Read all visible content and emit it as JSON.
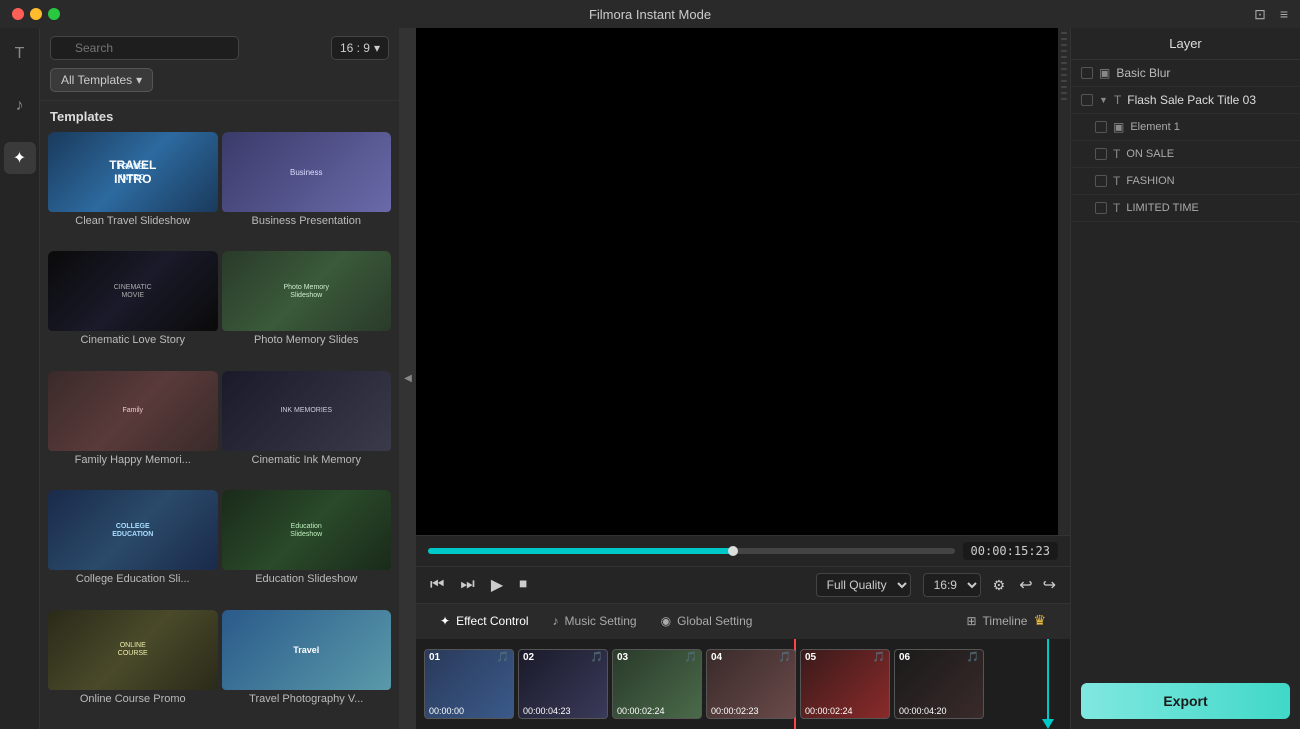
{
  "app": {
    "title": "Filmora Instant Mode",
    "titlebar_icons": [
      "save-icon",
      "menu-icon"
    ]
  },
  "sidebar": {
    "items": [
      {
        "label": "T",
        "name": "text-tool",
        "active": false
      },
      {
        "label": "♪",
        "name": "audio-tool",
        "active": false
      },
      {
        "label": "✦",
        "name": "effects-tool",
        "active": true
      }
    ]
  },
  "templates_panel": {
    "title": "Templates",
    "search_placeholder": "Search",
    "aspect_ratio": "16 : 9",
    "filter_label": "All Templates",
    "items": [
      {
        "name": "Clean Travel Slideshow",
        "thumb_class": "thumb-travel",
        "thumb_text": "TRAVEL\nINTRO"
      },
      {
        "name": "Business Presentation",
        "thumb_class": "thumb-business",
        "thumb_text": ""
      },
      {
        "name": "Cinematic Love Story",
        "thumb_class": "thumb-cinematic",
        "thumb_text": "CINEMATIC\nMOVIE"
      },
      {
        "name": "Photo Memory Slides",
        "thumb_class": "thumb-photo",
        "thumb_text": "Photo Memory\nSlideshow"
      },
      {
        "name": "Family Happy Memori...",
        "thumb_class": "thumb-family",
        "thumb_text": ""
      },
      {
        "name": "Cinematic Ink Memory",
        "thumb_class": "thumb-ink",
        "thumb_text": "INK MEMORIES"
      },
      {
        "name": "College Education Sli...",
        "thumb_class": "thumb-college",
        "thumb_text": "COLLEGE\nEDUCATION"
      },
      {
        "name": "Education Slideshow",
        "thumb_class": "thumb-education",
        "thumb_text": "Education\nSlideshow"
      },
      {
        "name": "Online Course Promo",
        "thumb_class": "thumb-online",
        "thumb_text": "ONLINE\nCOURSE"
      },
      {
        "name": "Travel Photography V...",
        "thumb_class": "thumb-photo2",
        "thumb_text": "Travel"
      }
    ]
  },
  "controls": {
    "time": "00:00:15:23",
    "quality_label": "Full Quality",
    "aspect_label": "16:9",
    "tabs": [
      {
        "label": "Effect Control",
        "icon": "✦"
      },
      {
        "label": "Music Setting",
        "icon": "♪"
      },
      {
        "label": "Global Setting",
        "icon": "◉"
      }
    ],
    "timeline_label": "Timeline"
  },
  "layers": {
    "title": "Layer",
    "items": [
      {
        "label": "Basic Blur",
        "level": 0,
        "icon": "▣",
        "type": "effect"
      },
      {
        "label": "Flash Sale Pack Title 03",
        "level": 0,
        "icon": "T",
        "type": "text",
        "expanded": true
      },
      {
        "label": "Element 1",
        "level": 1,
        "icon": "▣",
        "type": "element"
      },
      {
        "label": "ON SALE",
        "level": 1,
        "icon": "T",
        "type": "text"
      },
      {
        "label": "FASHION",
        "level": 1,
        "icon": "T",
        "type": "text"
      },
      {
        "label": "LIMITED TIME",
        "level": 1,
        "icon": "T",
        "type": "text"
      }
    ]
  },
  "timeline": {
    "clips": [
      {
        "number": "01",
        "time": "00:00:00",
        "class": "clip-1"
      },
      {
        "number": "02",
        "time": "00:00:04:23",
        "class": "clip-2"
      },
      {
        "number": "03",
        "time": "00:00:02:24",
        "class": "clip-3"
      },
      {
        "number": "04",
        "time": "00:00:02:23",
        "class": "clip-4"
      },
      {
        "number": "05",
        "time": "00:00:02:24",
        "class": "clip-5"
      },
      {
        "number": "06",
        "time": "00:00:04:20",
        "class": "clip-6"
      }
    ]
  },
  "export": {
    "label": "Export"
  }
}
